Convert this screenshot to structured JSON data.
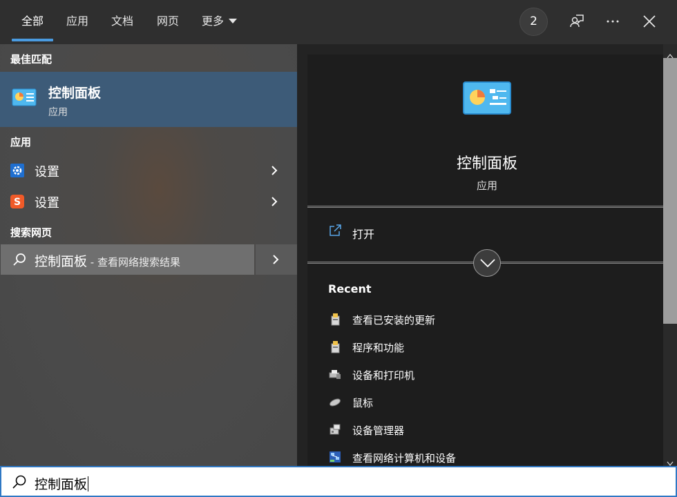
{
  "tabs": [
    {
      "label": "全部",
      "active": true
    },
    {
      "label": "应用"
    },
    {
      "label": "文档"
    },
    {
      "label": "网页"
    },
    {
      "label": "更多"
    }
  ],
  "header": {
    "badge_count": "2",
    "icons": [
      "feedback-icon",
      "more-options-icon",
      "close-icon"
    ]
  },
  "left": {
    "best_match_heading": "最佳匹配",
    "best_match": {
      "title": "控制面板",
      "subtitle": "应用",
      "icon": "control-panel-icon"
    },
    "apps_heading": "应用",
    "apps": [
      {
        "label": "设置",
        "icon": "gear-icon"
      },
      {
        "label": "设置",
        "icon": "sogou-s-icon"
      }
    ],
    "web_heading": "搜索网页",
    "web_search": {
      "query": "控制面板",
      "hint": " - 查看网络搜索结果"
    }
  },
  "preview": {
    "title": "控制面板",
    "subtitle": "应用",
    "open_label": "打开",
    "recent_heading": "Recent",
    "recent": [
      {
        "label": "查看已安装的更新",
        "icon": "programs-icon"
      },
      {
        "label": "程序和功能",
        "icon": "programs-icon"
      },
      {
        "label": "设备和打印机",
        "icon": "printer-icon"
      },
      {
        "label": "鼠标",
        "icon": "mouse-icon"
      },
      {
        "label": "设备管理器",
        "icon": "device-manager-icon"
      },
      {
        "label": "查看网络计算机和设备",
        "icon": "network-icon"
      }
    ]
  },
  "search": {
    "value": "控制面板"
  },
  "colors": {
    "accent": "#4a9be0",
    "selected_bg": "#3d5b78",
    "search_border": "#2f78c4"
  }
}
